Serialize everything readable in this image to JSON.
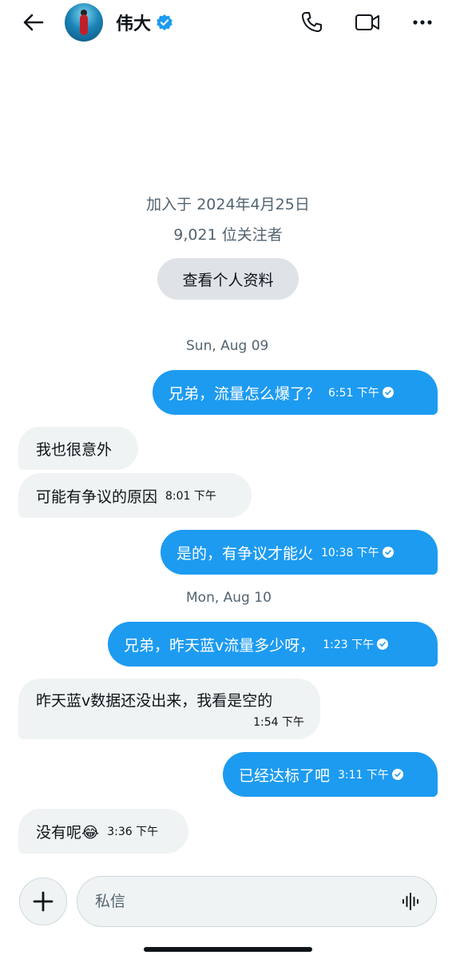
{
  "header": {
    "display_name": "伟大"
  },
  "profile": {
    "joined": "加入于 2024年4月25日",
    "followers": "9,021 位关注者",
    "view_profile_label": "查看个人资料"
  },
  "dates": [
    "Sun, Aug 09",
    "Mon, Aug 10"
  ],
  "messages": [
    {
      "direction": "out",
      "text": "兄弟，流量怎么爆了？",
      "time": "6:51 下午",
      "read": true
    },
    {
      "direction": "in",
      "text": "我也很意外",
      "time": ""
    },
    {
      "direction": "in",
      "text": "可能有争议的原因",
      "time": "8:01 下午"
    },
    {
      "direction": "out",
      "text": "是的，有争议才能火",
      "time": "10:38 下午",
      "read": true
    },
    {
      "direction": "out",
      "text": "兄弟，昨天蓝v流量多少呀，",
      "time": "1:23 下午",
      "read": true
    },
    {
      "direction": "in",
      "text": "昨天蓝v数据还没出来，我看是空的",
      "time": "1:54 下午"
    },
    {
      "direction": "out",
      "text": "已经达标了吧",
      "time": "3:11 下午",
      "read": true
    },
    {
      "direction": "in",
      "text": "没有呢😂",
      "time": "3:36 下午"
    }
  ],
  "composer": {
    "placeholder": "私信"
  },
  "colors": {
    "accent": "#1d9bf0",
    "incoming_bubble": "#eff3f4",
    "secondary_text": "#536471",
    "profile_button_bg": "#dfe3e8"
  },
  "icons": [
    "back-arrow-icon",
    "verified-badge-icon",
    "phone-icon",
    "video-camera-icon",
    "more-icon",
    "plus-icon",
    "voice-waveform-icon",
    "read-check-icon"
  ]
}
